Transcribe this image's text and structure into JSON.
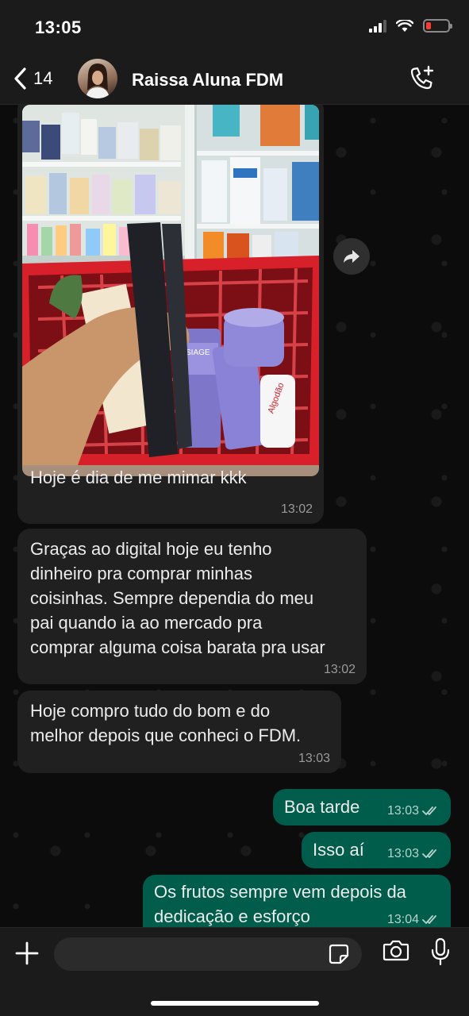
{
  "status_bar": {
    "time": "13:05"
  },
  "header": {
    "back_count": "14",
    "contact_name": "Raissa Aluna FDM",
    "icons": {
      "back": "chevron-left-icon",
      "call": "phone-add-icon"
    }
  },
  "messages": [
    {
      "direction": "in",
      "type": "image",
      "caption": "Hoje é dia de me mimar kkk",
      "time": "13:02",
      "photo_labels": [
        "SIAGE",
        "Algodão"
      ]
    },
    {
      "direction": "in",
      "type": "text",
      "lines": [
        "Graças ao digital hoje eu tenho",
        "dinheiro pra comprar minhas",
        "coisinhas. Sempre dependia do meu",
        "pai quando ia ao mercado pra",
        "comprar alguma coisa barata pra usar"
      ],
      "time": "13:02"
    },
    {
      "direction": "in",
      "type": "text",
      "lines": [
        "Hoje compro tudo do bom e do",
        "melhor depois que conheci o FDM."
      ],
      "time": "13:03"
    },
    {
      "direction": "out",
      "type": "text",
      "text": "Boa tarde",
      "time": "13:03",
      "read": true
    },
    {
      "direction": "out",
      "type": "text",
      "text": "Isso aí",
      "time": "13:03",
      "read": true
    },
    {
      "direction": "out",
      "type": "text",
      "lines": [
        "Os frutos sempre vem depois da",
        "dedicação e esforço"
      ],
      "time": "13:04",
      "read": true
    }
  ],
  "composer": {
    "placeholder": ""
  },
  "colors": {
    "incoming": "#202020",
    "outgoing": "#005c4b",
    "background": "#0c0c0c",
    "battery_low": "#ff3b30",
    "read_ticks": "#9ecfc4"
  }
}
